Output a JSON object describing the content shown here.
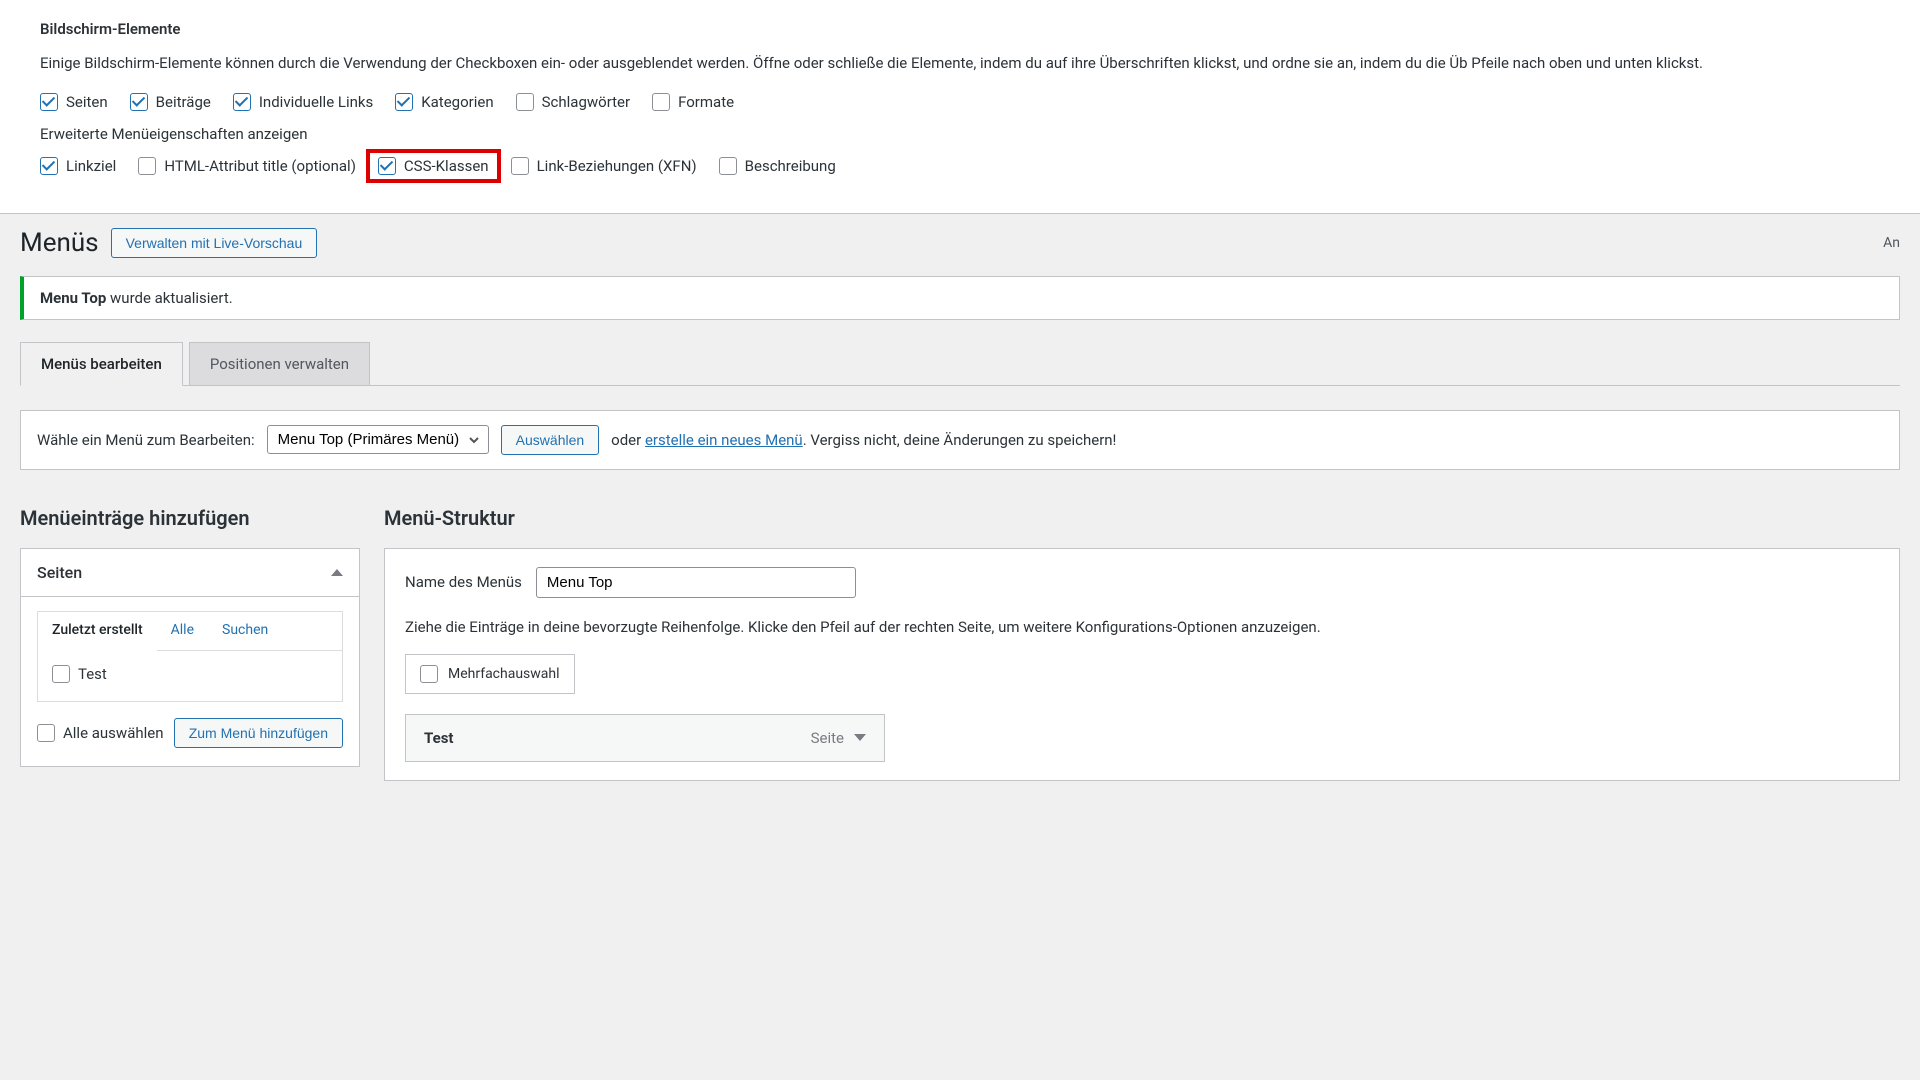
{
  "screenOptions": {
    "heading": "Bildschirm-Elemente",
    "description": "Einige Bildschirm-Elemente können durch die Verwendung der Checkboxen ein- oder ausgeblendet werden. Öffne oder schließe die Elemente, indem du auf ihre Überschriften klickst, und ordne sie an, indem du die Üb Pfeile nach oben und unten klickst.",
    "boxes": [
      {
        "label": "Seiten",
        "checked": true
      },
      {
        "label": "Beiträge",
        "checked": true
      },
      {
        "label": "Individuelle Links",
        "checked": true
      },
      {
        "label": "Kategorien",
        "checked": true
      },
      {
        "label": "Schlagwörter",
        "checked": false
      },
      {
        "label": "Formate",
        "checked": false
      }
    ],
    "advancedHeading": "Erweiterte Menüeigenschaften anzeigen",
    "advanced": [
      {
        "label": "Linkziel",
        "checked": true,
        "highlight": false
      },
      {
        "label": "HTML-Attribut title (optional)",
        "checked": false,
        "highlight": false
      },
      {
        "label": "CSS-Klassen",
        "checked": true,
        "highlight": true
      },
      {
        "label": "Link-Beziehungen (XFN)",
        "checked": false,
        "highlight": false
      },
      {
        "label": "Beschreibung",
        "checked": false,
        "highlight": false
      }
    ]
  },
  "header": {
    "title": "Menüs",
    "livePreview": "Verwalten mit Live-Vorschau",
    "screenToggle": "An"
  },
  "notice": {
    "boldPart": "Menu Top",
    "rest": " wurde aktualisiert."
  },
  "tabs": {
    "edit": "Menüs bearbeiten",
    "positions": "Positionen verwalten"
  },
  "selectBar": {
    "label": "Wähle ein Menü zum Bearbeiten:",
    "selected": "Menu Top (Primäres Menü)",
    "selectBtn": "Auswählen",
    "or": "oder ",
    "createLink": "erstelle ein neues Menü",
    "reminder": ". Vergiss nicht, deine Änderungen zu speichern!"
  },
  "addItems": {
    "title": "Menüeinträge hinzufügen",
    "panelTitle": "Seiten",
    "innerTabs": {
      "recent": "Zuletzt erstellt",
      "all": "Alle",
      "search": "Suchen"
    },
    "items": [
      {
        "label": "Test",
        "checked": false
      }
    ],
    "selectAll": "Alle auswählen",
    "addBtn": "Zum Menü hinzufügen"
  },
  "structure": {
    "title": "Menü-Struktur",
    "nameLabel": "Name des Menüs",
    "nameValue": "Menu Top",
    "desc": "Ziehe die Einträge in deine bevorzugte Reihenfolge. Klicke den Pfeil auf der rechten Seite, um weitere Konfigurations-Optionen anzuzeigen.",
    "bulkSelect": "Mehrfachauswahl",
    "menuItems": [
      {
        "label": "Test",
        "type": "Seite"
      }
    ]
  }
}
